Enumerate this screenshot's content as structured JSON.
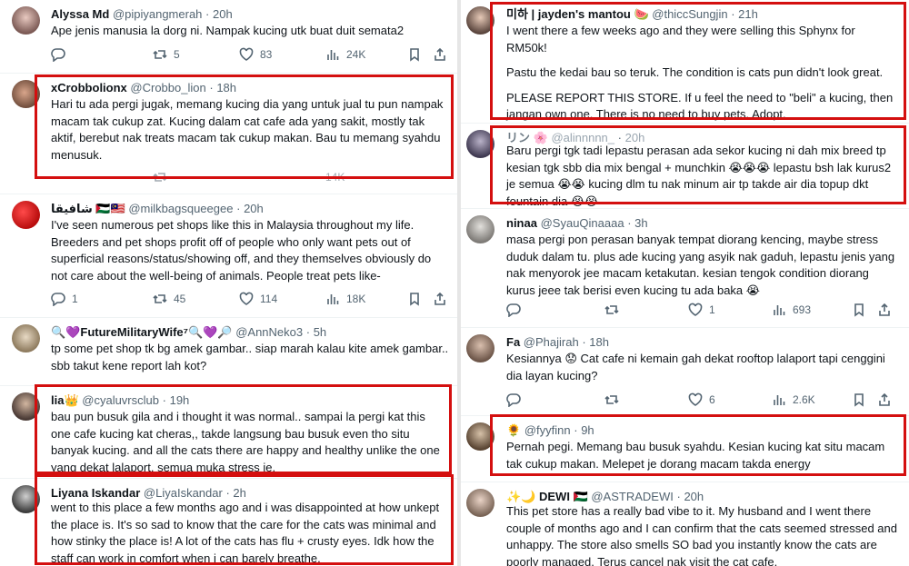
{
  "left": {
    "t1": {
      "name": "Alyssa Md",
      "handle": "@pipiyangmerah",
      "time": "20h",
      "text": "Ape jenis manusia la dorg ni. Nampak kucing utk buat duit semata2",
      "replies": "",
      "reposts": "5",
      "likes": "83",
      "views": "24K"
    },
    "t2": {
      "name": "xCrobbolionx",
      "handle": "@Crobbo_lion",
      "time": "18h",
      "text": "Hari tu ada pergi jugak, memang kucing dia yang untuk jual tu pun nampak macam tak cukup zat. Kucing dalam cat cafe ada yang sakit, mostly tak aktif, berebut nak treats macam tak cukup makan. Bau tu memang syahdu menusuk.",
      "views": "14K"
    },
    "t3": {
      "name": "شافيقا 🇵🇸🇲🇾",
      "handle": "@milkbagsqueegee",
      "time": "20h",
      "text": "I've seen numerous pet shops like this in Malaysia throughout my life. Breeders and pet shops profit off of people who only want pets out of superficial reasons/status/showing off, and they themselves obviously do not care about the well-being of animals. People treat pets like-",
      "replies": "1",
      "reposts": "45",
      "likes": "114",
      "views": "18K"
    },
    "t4": {
      "name": "🔍💜FutureMilitaryWife⁷🔍💜🔎",
      "handle": "@AnnNeko3",
      "time": "5h",
      "text": "tp some pet shop tk bg amek gambar.. siap marah kalau kite amek gambar.. sbb takut kene report lah kot?"
    },
    "t5": {
      "name": "lia👑",
      "handle": "@cyaluvrsclub",
      "time": "19h",
      "text": "bau pun busuk gila and i thought it was normal.. sampai la pergi kat this one cafe kucing kat cheras,, takde langsung bau busuk even tho situ banyak kucing. and all the cats there are happy and healthy unlike the one yang dekat lalaport, semua muka stress je."
    },
    "t6": {
      "name": "Liyana Iskandar",
      "handle": "@LiyaIskandar",
      "time": "2h",
      "text": "went to this place a few months ago and i was disappointed at how unkept the place is. It's so sad to know that the care for the cats was minimal and how stinky the place is! A lot of the cats has flu + crusty eyes. Idk how the staff can work in comfort when i can barely breathe."
    }
  },
  "right": {
    "t1": {
      "name": "미하 | jayden's mantou 🍉",
      "handle": "@thiccSungjin",
      "time": "21h",
      "p1": "I went there a few weeks ago and they were selling this Sphynx for RM50k!",
      "p2": "Pastu the kedai bau so teruk. The condition is cats pun didn't look great.",
      "p3": "PLEASE REPORT THIS STORE. If u feel the need to \"beli\" a kucing, then jangan own one. There is no need to buy pets. Adopt."
    },
    "t2": {
      "name": "リン 🌸",
      "handle": "@alinnnnn_",
      "time": "20h",
      "text": "Baru pergi tgk tadi lepastu perasan ada sekor kucing ni dah mix breed tp kesian tgk sbb dia mix bengal + munchkin 😭😭😭 lepastu bsh lak kurus2 je semua 😭😭 kucing dlm tu nak minum air tp takde air dia topup dkt fountain dia 😭😭"
    },
    "t3": {
      "name": "ninaa",
      "handle": "@SyauQinaaaa",
      "time": "3h",
      "text": "masa pergi pon perasan banyak tempat diorang kencing, maybe stress duduk dalam tu. plus ade kucing yang asyik nak gaduh, lepastu jenis yang nak menyorok jee macam ketakutan. kesian tengok condition diorang kurus jeee tak berisi even kucing tu ada baka 😭",
      "replies": "",
      "reposts": "",
      "likes": "1",
      "views": "693"
    },
    "t4": {
      "name": "Fa",
      "handle": "@Phajirah",
      "time": "18h",
      "text": "Kesiannya 😟 Cat cafe ni kemain gah dekat rooftop lalaport tapi cenggini dia layan kucing?",
      "replies": "",
      "reposts": "",
      "likes": "6",
      "views": "2.6K"
    },
    "t5": {
      "name": "🌻",
      "handle": "@fyyfinn",
      "time": "9h",
      "text": "Pernah pegi. Memang bau busuk syahdu. Kesian kucing kat situ macam tak cukup makan. Melepet je dorang macam takda energy"
    },
    "t6": {
      "name": "✨🌙 DEWI 🇵🇸",
      "handle": "@ASTRADEWI",
      "time": "20h",
      "text": "This pet store has a really bad vibe to it. My husband and I went there couple of months ago and I can confirm that the cats seemed stressed and unhappy. The store also smells SO bad you instantly know the cats are poorly managed. Terus cancel nak visit the cat cafe."
    }
  },
  "icons": [
    "reply-icon",
    "repost-icon",
    "like-icon",
    "views-icon",
    "bookmark-icon",
    "share-icon"
  ],
  "colors": {
    "highlight": "#d40f0f",
    "handle": "#536471",
    "text": "#0f1419"
  }
}
